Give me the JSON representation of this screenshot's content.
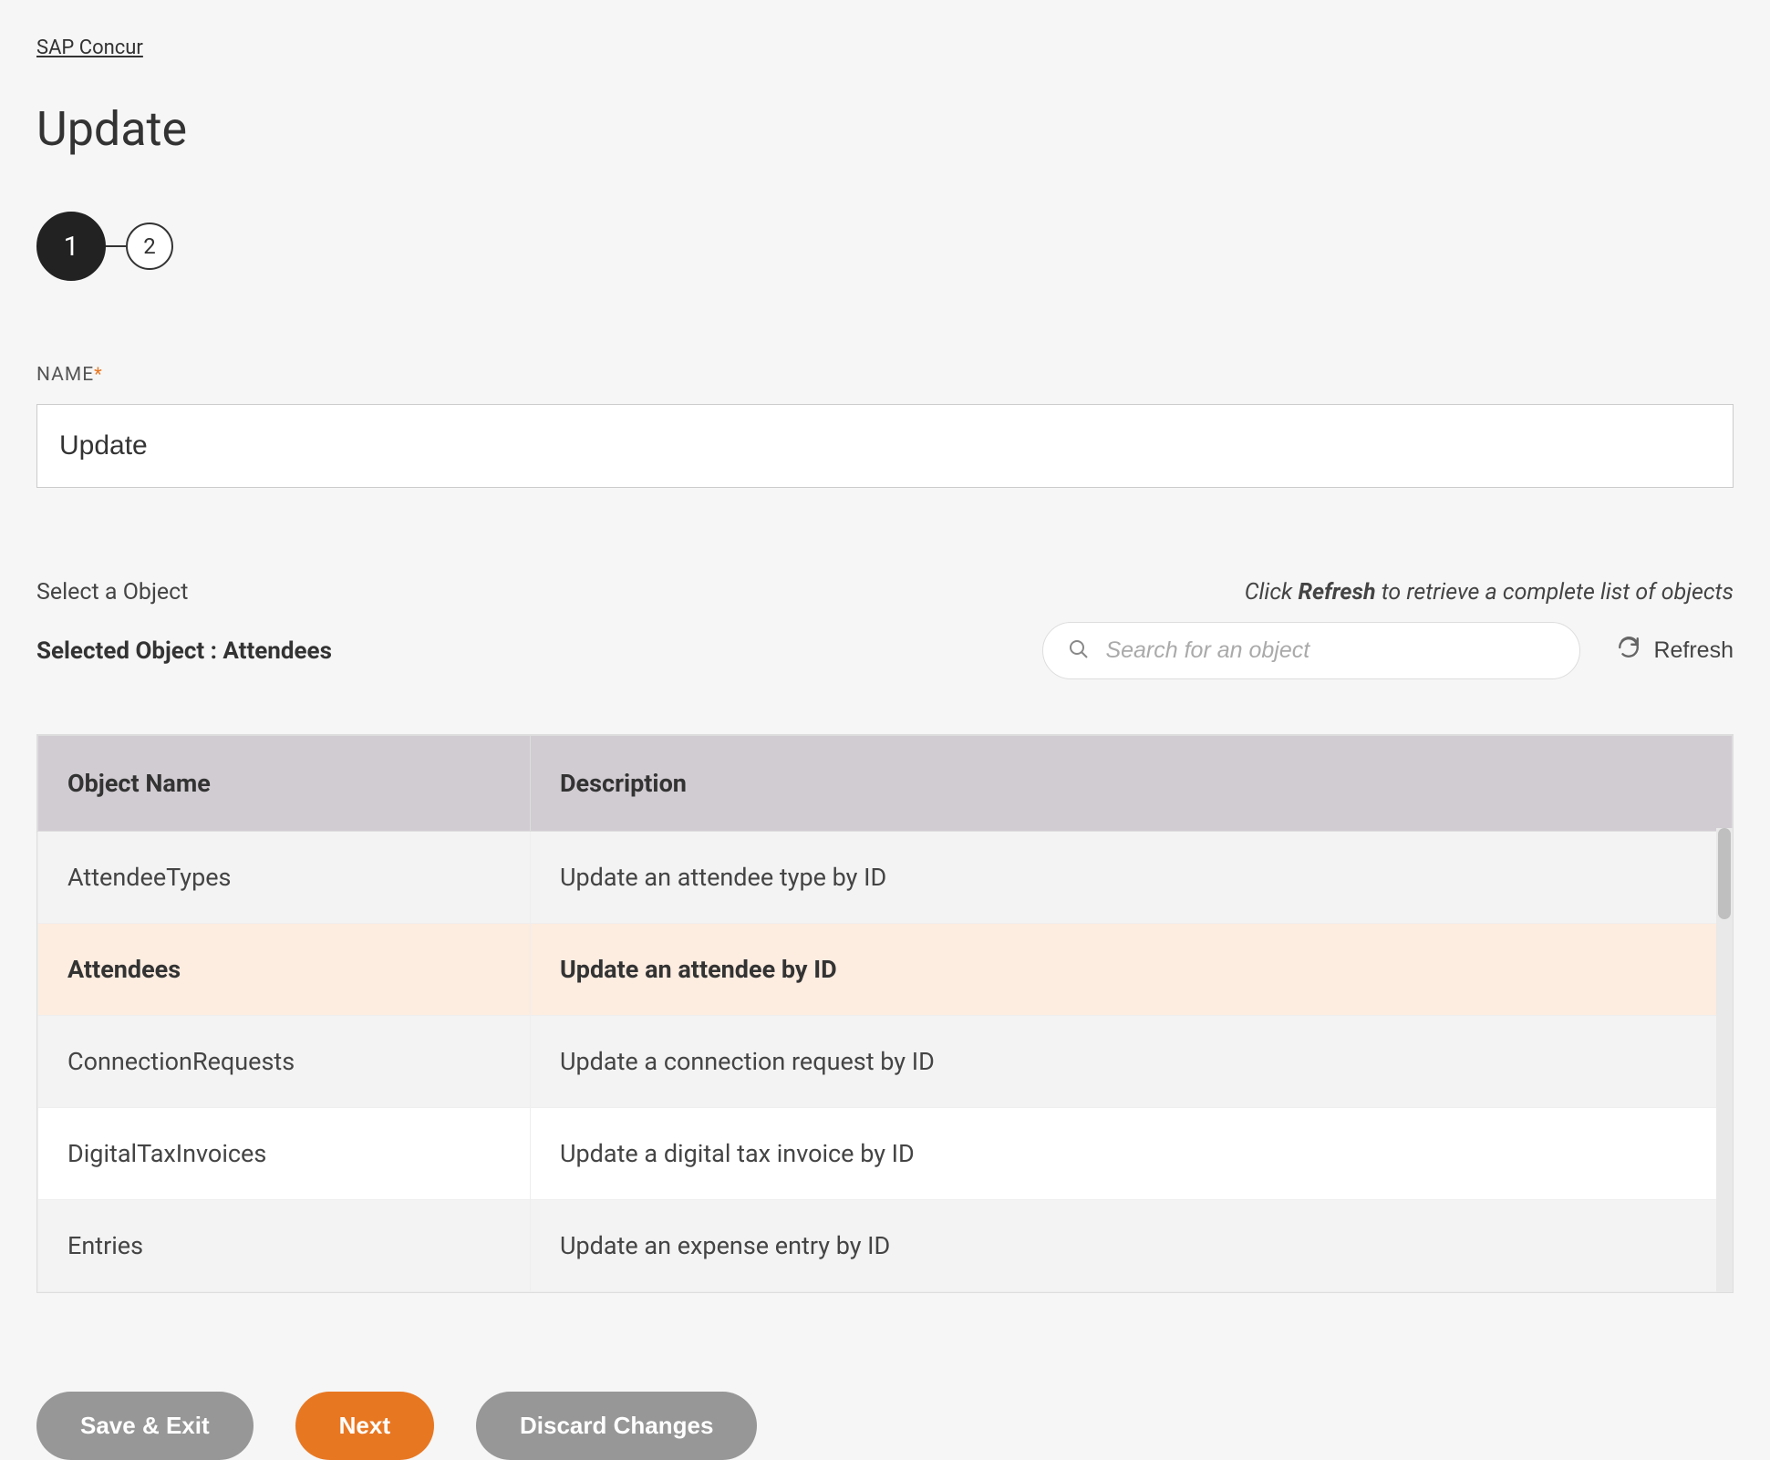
{
  "breadcrumb": "SAP Concur",
  "page_title": "Update",
  "stepper": {
    "step1": "1",
    "step2": "2"
  },
  "name_field": {
    "label": "NAME",
    "value": "Update"
  },
  "select_object_label": "Select a Object",
  "refresh_hint_prefix": "Click ",
  "refresh_hint_bold": "Refresh",
  "refresh_hint_suffix": " to retrieve a complete list of objects",
  "selected_object_label": "Selected Object : Attendees",
  "search_placeholder": "Search for an object",
  "refresh_button": "Refresh",
  "table": {
    "headers": {
      "name": "Object Name",
      "desc": "Description"
    },
    "rows": [
      {
        "name": "AttendeeTypes",
        "desc": "Update an attendee type by ID",
        "selected": false
      },
      {
        "name": "Attendees",
        "desc": "Update an attendee by ID",
        "selected": true
      },
      {
        "name": "ConnectionRequests",
        "desc": "Update a connection request by ID",
        "selected": false
      },
      {
        "name": "DigitalTaxInvoices",
        "desc": "Update a digital tax invoice by ID",
        "selected": false
      },
      {
        "name": "Entries",
        "desc": "Update an expense entry by ID",
        "selected": false
      }
    ]
  },
  "buttons": {
    "save_exit": "Save & Exit",
    "next": "Next",
    "discard": "Discard Changes"
  }
}
